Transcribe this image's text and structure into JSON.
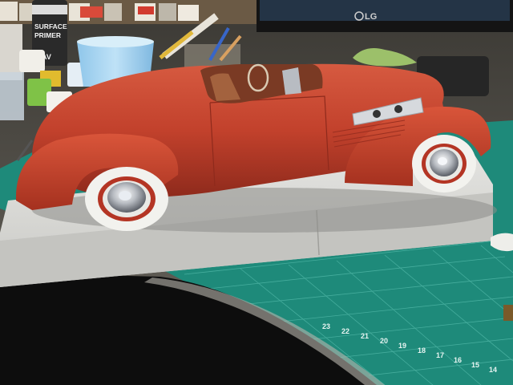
{
  "primer_bottle": {
    "brand": "AV",
    "line1": "SURFACE",
    "line2": "PRIMER"
  },
  "monitor": {
    "brand": "LG"
  },
  "cutting_mat": {
    "ruler_numbers": [
      "23",
      "22",
      "21",
      "20",
      "19",
      "18",
      "17",
      "16",
      "15",
      "14"
    ]
  },
  "colors": {
    "car_body": "#c2412c",
    "mat_green": "#1e8a7a",
    "base_board": "#d9d9d6",
    "whitewall": "#f2f2ee"
  }
}
